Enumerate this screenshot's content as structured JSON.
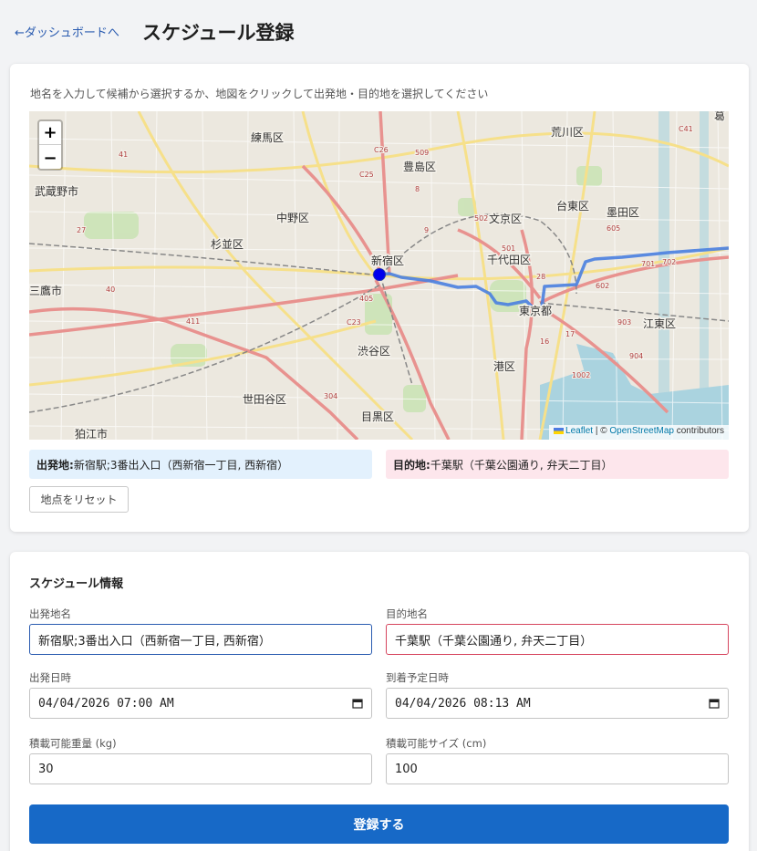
{
  "header": {
    "back_label": "←ダッシュボードへ",
    "title": "スケジュール登録"
  },
  "map_section": {
    "instruction": "地名を入力して候補から選択するか、地図をクリックして出発地・目的地を選択してください",
    "zoom_in": "+",
    "zoom_out": "−",
    "attribution_leaflet": "Leaflet",
    "attribution_sep": " | © ",
    "attribution_osm": "OpenStreetMap",
    "attribution_tail": " contributors",
    "district_labels": [
      {
        "name": "練馬区"
      },
      {
        "name": "豊島区"
      },
      {
        "name": "荒川区"
      },
      {
        "name": "葛"
      },
      {
        "name": "武蔵野市"
      },
      {
        "name": "中野区"
      },
      {
        "name": "文京区"
      },
      {
        "name": "台東区"
      },
      {
        "name": "墨田区"
      },
      {
        "name": "杉並区"
      },
      {
        "name": "新宿区"
      },
      {
        "name": "千代田区"
      },
      {
        "name": "三鷹市"
      },
      {
        "name": "東京都"
      },
      {
        "name": "江東区"
      },
      {
        "name": "渋谷区"
      },
      {
        "name": "港区"
      },
      {
        "name": "世田谷区"
      },
      {
        "name": "目黒区"
      },
      {
        "name": "狛江市"
      }
    ],
    "road_numbers": [
      {
        "name": "C26"
      },
      {
        "name": "509"
      },
      {
        "name": "C25"
      },
      {
        "name": "8"
      },
      {
        "name": "41"
      },
      {
        "name": "27"
      },
      {
        "name": "9"
      },
      {
        "name": "502"
      },
      {
        "name": "501"
      },
      {
        "name": "28"
      },
      {
        "name": "602"
      },
      {
        "name": "701"
      },
      {
        "name": "702"
      },
      {
        "name": "40"
      },
      {
        "name": "405"
      },
      {
        "name": "411"
      },
      {
        "name": "C23"
      },
      {
        "name": "903"
      },
      {
        "name": "904"
      },
      {
        "name": "1002"
      },
      {
        "name": "304"
      },
      {
        "name": "C41"
      },
      {
        "name": "605"
      },
      {
        "name": "16"
      },
      {
        "name": "17"
      }
    ],
    "origin_label": "出発地:",
    "origin_value": "新宿駅;3番出入口（西新宿一丁目, 西新宿）",
    "dest_label": "目的地:",
    "dest_value": "千葉駅（千葉公園通り, 弁天二丁目）",
    "reset_label": "地点をリセット"
  },
  "form": {
    "section_title": "スケジュール情報",
    "origin_name_label": "出発地名",
    "origin_name_value": "新宿駅;3番出入口（西新宿一丁目, 西新宿）",
    "dest_name_label": "目的地名",
    "dest_name_value": "千葉駅（千葉公園通り, 弁天二丁目）",
    "depart_label": "出発日時",
    "depart_value": "04/04/2026 07:00 AM",
    "arrive_label": "到着予定日時",
    "arrive_value": "04/04/2026 08:13 AM",
    "weight_label": "積載可能重量 (kg)",
    "weight_value": "30",
    "size_label": "積載可能サイズ (cm)",
    "size_value": "100",
    "submit_label": "登録する"
  },
  "colors": {
    "accent": "#1769c7",
    "route": "#4a7fe0",
    "origin_bg": "#e3f1fd",
    "dest_bg": "#fde6ec",
    "marker": "#0000ee"
  }
}
